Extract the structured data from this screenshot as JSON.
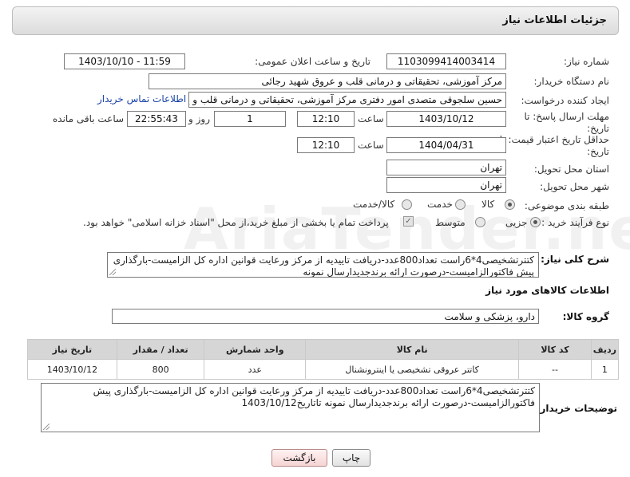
{
  "header": {
    "title": "جزئیات اطلاعات نیاز"
  },
  "fields": {
    "need_number_label": "شماره نیاز:",
    "need_number": "1103099414003414",
    "announce_label": "تاریخ و ساعت اعلان عمومی:",
    "announce_value": "1403/10/10 - 11:59",
    "buyer_label": "نام دستگاه خریدار:",
    "buyer_value": "مرکز آموزشی، تحقیقاتی و درمانی قلب و عروق شهید رجائی",
    "creator_label": "ایجاد کننده درخواست:",
    "creator_value": "حسین سلجوقی متصدی امور دفتری مرکز آموزشی، تحقیقاتی و درمانی قلب و ع",
    "contact_link": "اطلاعات تماس خریدار",
    "deadline_label_1": "مهلت ارسال پاسخ: تا",
    "deadline_label_2": "تاریخ:",
    "deadline_date": "1403/10/12",
    "time_word": "ساعت",
    "deadline_time": "12:10",
    "days_value": "1",
    "days_word": "روز و",
    "remaining_time": "22:55:43",
    "remaining_word": "ساعت باقی مانده",
    "validity_label_1": "حداقل تاریخ اعتبار قیمت: تا",
    "validity_label_2": "تاریخ:",
    "validity_date": "1404/04/31",
    "validity_time": "12:10",
    "province_label": "استان محل تحویل:",
    "province_value": "تهران",
    "city_label": "شهر محل تحویل:",
    "city_value": "تهران",
    "category_label": "طبقه بندی موضوعی:",
    "category_options": [
      "کالا",
      "خدمت",
      "کالا/خدمت"
    ],
    "process_label": "نوع فرآیند خرید :",
    "process_options": [
      "جزیی",
      "متوسط"
    ],
    "payment_note": "پرداخت تمام یا بخشی از مبلغ خرید،از محل \"اسناد خزانه اسلامی\" خواهد بود."
  },
  "description": {
    "label": "شرح کلی نیاز:",
    "text": "کتترتشخیصی4*6راست تعداد800عدد-دریافت تاییدیه از مرکز ورعایت قوانین اداره کل الزامیست-بارگذاری پیش فاکتورالزامیست-درصورت ارائه برندجدیدارسال نمونه"
  },
  "goods": {
    "section_title": "اطلاعات کالاهای مورد نیاز",
    "group_label": "گروه کالا:",
    "group_value": "دارو، پزشکی و سلامت",
    "columns": [
      "ردیف",
      "کد کالا",
      "نام کالا",
      "واحد شمارش",
      "تعداد / مقدار",
      "تاریخ نیاز"
    ],
    "rows": [
      [
        "1",
        "--",
        "کاتتر عروقی تشخیصی یا اینترونشنال",
        "عدد",
        "800",
        "1403/10/12"
      ]
    ]
  },
  "buyer_notes": {
    "label": "توضیحات خریدار:",
    "text": "کتترتشخیصی4*6راست تعداد800عدد-دریافت تاییدیه از مرکز ورعایت قوانین اداره کل الزامیست-بارگذاری پیش فاکتورالزامیست-درصورت ارائه برندجدیدارسال نمونه تاتاریخ1403/10/12"
  },
  "buttons": {
    "print": "چاپ",
    "back": "بازگشت"
  },
  "watermark": "AriaTender.neT"
}
